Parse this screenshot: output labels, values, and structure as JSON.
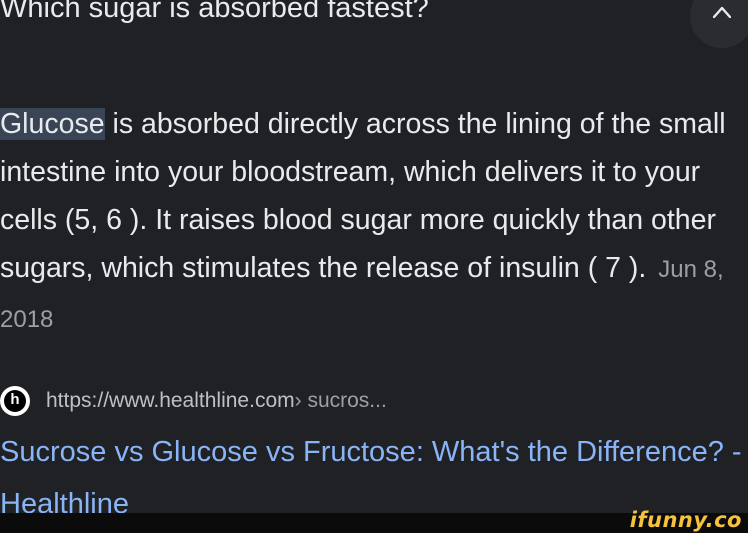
{
  "question": {
    "text": "Which sugar is absorbed fastest?"
  },
  "collapse_button": {
    "icon": "chevron-up-icon"
  },
  "answer": {
    "highlight": "Glucose",
    "body": " is absorbed directly across the lining of the small intestine into your bloodstream, which delivers it to your cells (5, 6 ). It raises blood sugar more quickly than other sugars, which stimulates the release of insulin ( 7 ).",
    "date": "Jun 8, 2018"
  },
  "source": {
    "favicon": "healthline-logo-icon",
    "url": "https://www.healthline.com",
    "breadcrumb": " › sucros..."
  },
  "result": {
    "title": "Sucrose vs Glucose vs Fructose: What's the Difference? - Healthline"
  },
  "watermark": {
    "text": "ifunny.co"
  },
  "colors": {
    "background": "#202124",
    "text": "#e8eaed",
    "link": "#8ab4f8",
    "highlight": "#394457",
    "muted": "#9aa0a6",
    "watermark": "#f6c23e"
  }
}
